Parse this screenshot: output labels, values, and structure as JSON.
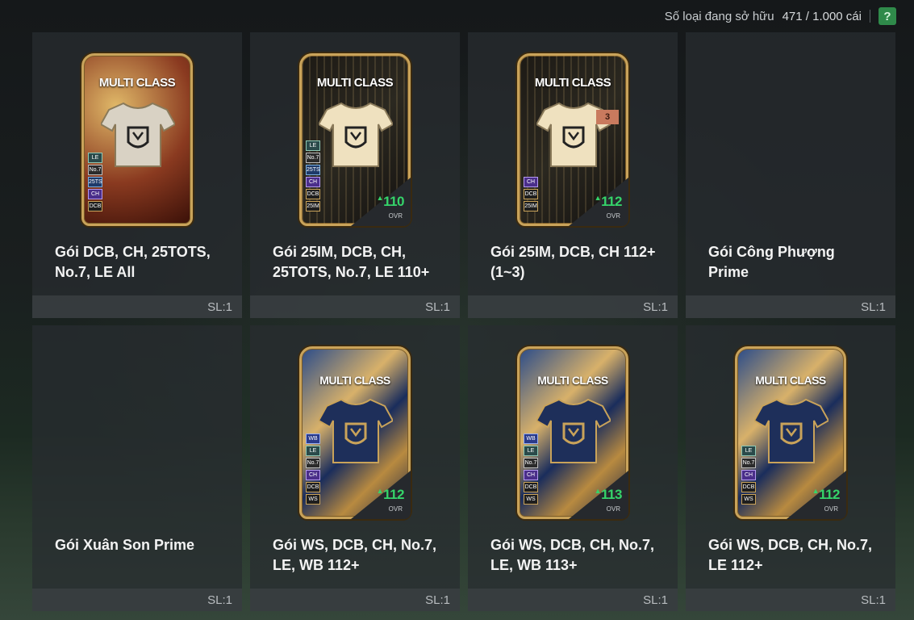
{
  "header": {
    "owned_label": "Số loại đang sở hữu",
    "owned_count": "471 / 1.000 cái",
    "help_label": "?"
  },
  "colors": {
    "accent_green": "#35d46a",
    "help_button": "#2f8a4a",
    "tile_bg": "#282d30"
  },
  "packs": [
    {
      "title": "Gói DCB, CH, 25TOTS, No.7, LE All",
      "qty": "SL:1",
      "card": {
        "style": "gold",
        "label": "MULTI CLASS",
        "tags": [
          "LE",
          "No.7",
          "25TS",
          "CH",
          "DCB"
        ],
        "ovr": "",
        "ovr_label": ""
      }
    },
    {
      "title": "Gói 25IM, DCB, CH, 25TOTS, No.7, LE 110+",
      "qty": "SL:1",
      "card": {
        "style": "dark",
        "label": "MULTI CLASS",
        "tags": [
          "LE",
          "No.7",
          "25TS",
          "CH",
          "DCB",
          "25IM"
        ],
        "ovr": "110",
        "ovr_label": "OVR"
      }
    },
    {
      "title": "Gói 25IM, DCB, CH 112+ (1~3)",
      "qty": "SL:1",
      "card": {
        "style": "dark",
        "label": "MULTI CLASS",
        "tags": [
          "CH",
          "DCB",
          "25IM"
        ],
        "ovr": "112",
        "ovr_label": "OVR",
        "badge": "3"
      }
    },
    {
      "title": "Gói Công Phượng Prime",
      "qty": "SL:1"
    },
    {
      "title": "Gói Xuân Son Prime",
      "qty": "SL:1"
    },
    {
      "title": "Gói WS, DCB, CH, No.7, LE, WB 112+",
      "qty": "SL:1",
      "card": {
        "style": "blue",
        "label": "MULTI CLASS",
        "tags": [
          "WB",
          "LE",
          "No.7",
          "CH",
          "DCB",
          "WS"
        ],
        "ovr": "112",
        "ovr_label": "OVR"
      }
    },
    {
      "title": "Gói WS, DCB, CH, No.7, LE, WB 113+",
      "qty": "SL:1",
      "card": {
        "style": "blue",
        "label": "MULTI CLASS",
        "tags": [
          "WB",
          "LE",
          "No.7",
          "CH",
          "DCB",
          "WS"
        ],
        "ovr": "113",
        "ovr_label": "OVR"
      }
    },
    {
      "title": "Gói WS, DCB, CH, No.7, LE 112+",
      "qty": "SL:1",
      "card": {
        "style": "blue",
        "label": "MULTI CLASS",
        "tags": [
          "LE",
          "No.7",
          "CH",
          "DCB",
          "WS"
        ],
        "ovr": "112",
        "ovr_label": "OVR"
      }
    }
  ]
}
